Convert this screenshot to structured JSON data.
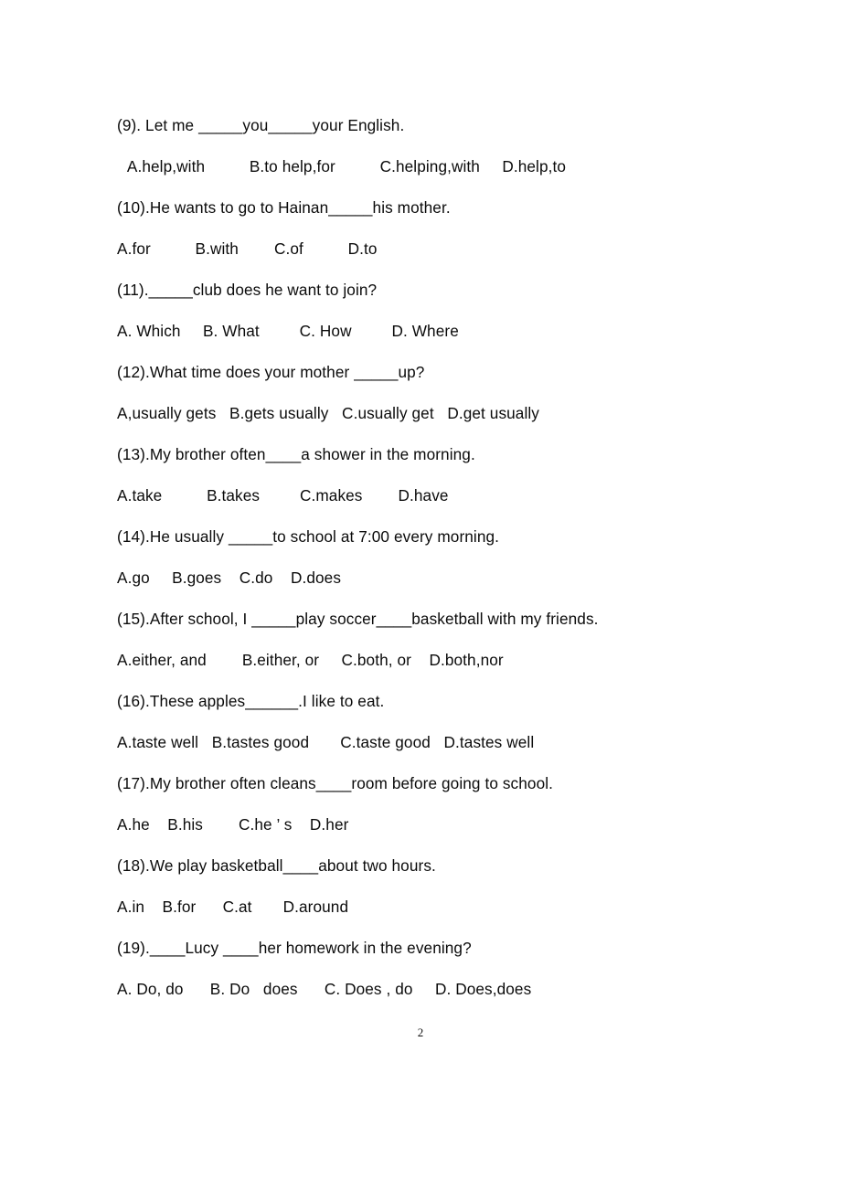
{
  "document": {
    "page_number": "2",
    "text_color": "#0b0b0b",
    "background_color": "#ffffff"
  },
  "questions": [
    {
      "id": "q9",
      "prompt": "(9). Let me _____you_____your English.",
      "options_line": " A.help,with          B.to help,for          C.helping,with     D.help,to",
      "indented_options": true
    },
    {
      "id": "q10",
      "prompt": "(10).He wants to go to Hainan_____his mother.",
      "options_line": "A.for          B.with        C.of          D.to",
      "indented_options": false
    },
    {
      "id": "q11",
      "prompt": "(11)._____club does he want to join?",
      "options_line": "A. Which     B. What         C. How         D. Where",
      "indented_options": false
    },
    {
      "id": "q12",
      "prompt": "(12).What time does your mother _____up?",
      "options_line": "A,usually gets   B.gets usually   C.usually get   D.get usually",
      "indented_options": false
    },
    {
      "id": "q13",
      "prompt": "(13).My brother often____a shower in the morning.",
      "options_line": "A.take          B.takes         C.makes        D.have",
      "indented_options": false
    },
    {
      "id": "q14",
      "prompt": "(14).He usually _____to school at 7:00 every morning.",
      "options_line": "A.go     B.goes    C.do    D.does",
      "indented_options": false
    },
    {
      "id": "q15",
      "prompt": "(15).After school, I _____play soccer____basketball with my friends.",
      "options_line": "A.either, and        B.either, or     C.both, or    D.both,nor",
      "indented_options": false
    },
    {
      "id": "q16",
      "prompt": "(16).These apples______.I like to eat.",
      "options_line": "A.taste well   B.tastes good       C.taste good   D.tastes well",
      "indented_options": false
    },
    {
      "id": "q17",
      "prompt": "(17).My brother often cleans____room before going to school.",
      "options_line": "A.he    B.his        C.he ’ s    D.her",
      "indented_options": false
    },
    {
      "id": "q18",
      "prompt": "(18).We play basketball____about two hours.",
      "options_line": "A.in    B.for      C.at       D.around",
      "indented_options": false
    },
    {
      "id": "q19",
      "prompt": "(19).____Lucy ____her homework in the evening?",
      "options_line": "A. Do, do      B. Do   does      C. Does , do     D. Does,does",
      "indented_options": false
    }
  ]
}
